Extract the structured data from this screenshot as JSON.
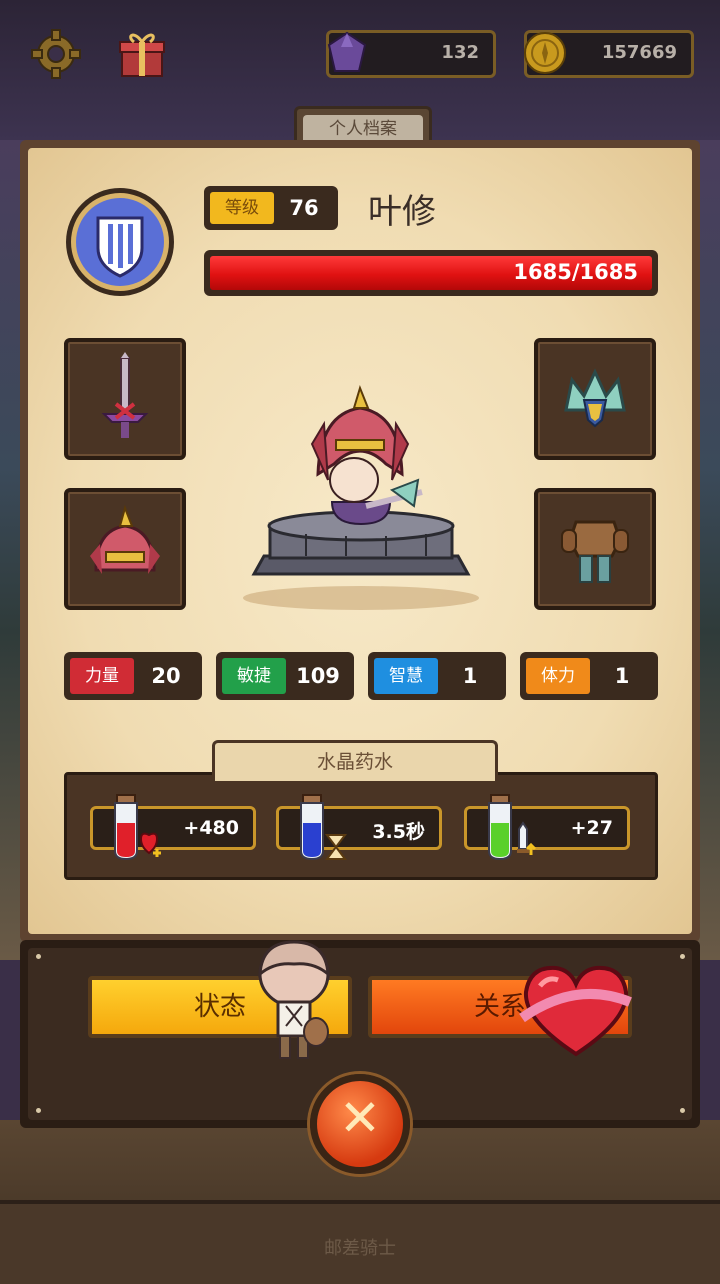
{
  "resources": {
    "gems": "132",
    "gold": "157669"
  },
  "tab_label": "个人档案",
  "hero": {
    "level_label": "等级",
    "level": "76",
    "name": "叶修",
    "hp_text": "1685/1685",
    "hp_fraction": 1.0
  },
  "stats": [
    {
      "label": "力量",
      "value": "20",
      "color": "#d02c35"
    },
    {
      "label": "敏捷",
      "value": "109",
      "color": "#22a04a"
    },
    {
      "label": "智慧",
      "value": "1",
      "color": "#1f8fe0"
    },
    {
      "label": "体力",
      "value": "1",
      "color": "#f08a1a"
    }
  ],
  "potions": {
    "title": "水晶药水",
    "items": [
      {
        "value": "+480",
        "icon": "red-potion-heart-icon"
      },
      {
        "value": "3.5秒",
        "icon": "blue-potion-hourglass-icon"
      },
      {
        "value": "+27",
        "icon": "green-potion-sword-icon"
      }
    ]
  },
  "actions": {
    "status": "状态",
    "relation": "关系"
  },
  "footer": "邮差骑士"
}
